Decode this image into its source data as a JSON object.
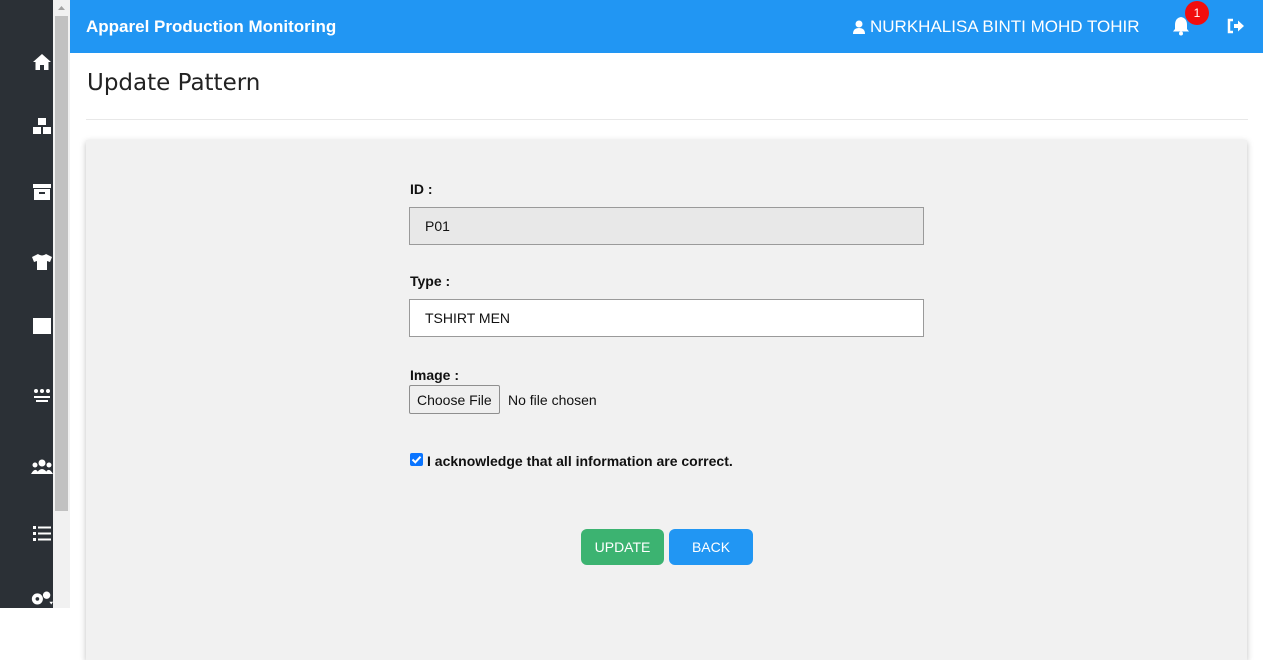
{
  "header": {
    "app_title": "Apparel Production Monitoring",
    "user_name": "NURKHALISA BINTI MOHD TOHIR",
    "notification_count": "1"
  },
  "sidebar": {
    "items": [
      {
        "icon": "home-icon"
      },
      {
        "icon": "boxes-icon"
      },
      {
        "icon": "archive-icon"
      },
      {
        "icon": "tshirt-icon"
      },
      {
        "icon": "square-icon"
      },
      {
        "icon": "pattern-icon"
      },
      {
        "icon": "users-icon"
      },
      {
        "icon": "list-icon"
      },
      {
        "icon": "settings-icon"
      }
    ]
  },
  "page": {
    "title": "Update Pattern"
  },
  "form": {
    "id_label": "ID :",
    "id_value": "P01",
    "type_label": "Type :",
    "type_value": "TSHIRT MEN",
    "image_label": "Image :",
    "choose_file_label": "Choose File",
    "file_status": "No file chosen",
    "acknowledge_label": "I acknowledge that all information are correct.",
    "acknowledge_checked": true,
    "update_label": "UPDATE",
    "back_label": "BACK"
  },
  "colors": {
    "topbar": "#2196f3",
    "sidebar": "#2b3036",
    "update_button": "#3cb371",
    "back_button": "#2196f3",
    "badge": "#f10d0d"
  }
}
